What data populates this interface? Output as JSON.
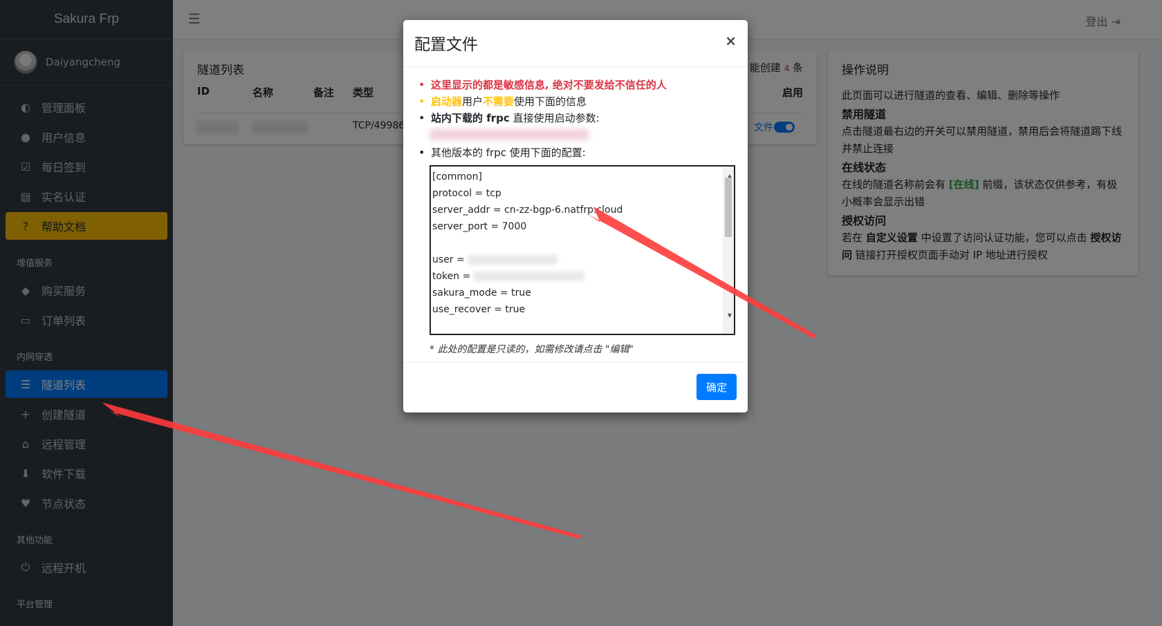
{
  "brand": "Sakura Frp",
  "user": {
    "name": "Daiyangcheng"
  },
  "sidebar": {
    "items_main": [
      {
        "label": "管理面板",
        "icon": "dashboard-icon"
      },
      {
        "label": "用户信息",
        "icon": "user-icon"
      },
      {
        "label": "每日签到",
        "icon": "checkbox-icon"
      },
      {
        "label": "实名认证",
        "icon": "id-card-icon"
      },
      {
        "label": "帮助文档",
        "icon": "question-icon"
      }
    ],
    "section_value": "增值服务",
    "items_value": [
      {
        "label": "购买服务",
        "icon": "diamond-icon"
      },
      {
        "label": "订单列表",
        "icon": "credit-card-icon"
      }
    ],
    "section_tunnel": "内网穿透",
    "items_tunnel": [
      {
        "label": "隧道列表",
        "icon": "list-icon"
      },
      {
        "label": "创建隧道",
        "icon": "plus-icon"
      },
      {
        "label": "远程管理",
        "icon": "remote-icon"
      },
      {
        "label": "软件下载",
        "icon": "download-icon"
      },
      {
        "label": "节点状态",
        "icon": "heartbeat-icon"
      }
    ],
    "section_other": "其他功能",
    "items_other": [
      {
        "label": "远程开机",
        "icon": "power-icon"
      }
    ],
    "section_platform": "平台管理"
  },
  "topbar": {
    "logout": "登出"
  },
  "tunnel_card": {
    "title": "隧道列表",
    "limit_prefix": "能创建",
    "limit_count": "4",
    "limit_suffix": "条",
    "columns": [
      "ID",
      "名称",
      "备注",
      "类型",
      "启用"
    ],
    "row": {
      "type": "TCP/49986",
      "action": "文件"
    }
  },
  "help_card": {
    "title": "操作说明",
    "intro": "此页面可以进行隧道的查看、编辑、删除等操作",
    "disable_title": "禁用隧道",
    "disable_text": "点击隧道最右边的开关可以禁用隧道，禁用后会将隧道踢下线并禁止连接",
    "online_title": "在线状态",
    "online_text_a": "在线的隧道名称前会有",
    "online_tag": "[在线]",
    "online_text_b": "前缀，该状态仅供参考，有极小概率会显示出错",
    "auth_title": "授权访问",
    "auth_text_a": "若在",
    "auth_bold_1": "自定义设置",
    "auth_text_b": "中设置了访问认证功能，您可以点击",
    "auth_bold_2": "授权访问",
    "auth_text_c": "链接打开授权页面手动对 IP 地址进行授权"
  },
  "modal": {
    "title": "配置文件",
    "close": "×",
    "warning": "这里显示的都是敏感信息, 绝对不要发给不信任的人",
    "launcher_a": "启动器",
    "launcher_b": "用户",
    "launcher_c": "不需要",
    "launcher_d": "使用下面的信息",
    "site_a": "站内下载的 frpc",
    "site_b": "直接使用启动参数:",
    "other": "其他版本的 frpc 使用下面的配置:",
    "config_lines": [
      "[common]",
      "protocol = tcp",
      "server_addr = cn-zz-bgp-6.natfrp.cloud",
      "server_port = 7000",
      "",
      "user =",
      "token =",
      "sakura_mode = true",
      "use_recover = true"
    ],
    "note": "* 此处的配置是只读的，如需修改请点击 \"编辑\"",
    "ok": "确定"
  },
  "colors": {
    "primary": "#007bff",
    "warning": "#ffc107",
    "danger": "#dc3545",
    "sidebar": "#343a40"
  }
}
